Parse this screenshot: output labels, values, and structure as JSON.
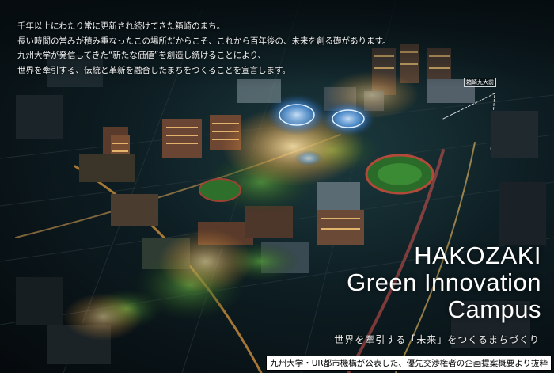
{
  "intro": {
    "lines": [
      "千年以上にわたり常に更新され続けてきた箱崎のまち。",
      "長い時間の営みが積み重なったこの場所だからこそ、これから百年後の、未来を創る礎があります。",
      "九州大学が発信してきた“新たな価値”を創造し続けることにより、",
      "世界を牽引する、伝統と革新を融合したまちをつくることを宣言します。"
    ]
  },
  "title": {
    "lines": [
      "HAKOZAKI",
      "Green Innovation",
      "Campus"
    ]
  },
  "tagline": "世界を牽引する「未来」をつくるまちづくり",
  "caption": "九州大学・UR都市機構が公表した、優先交渉権者の企画提案概要より抜粋",
  "sign": "箱崎九大前",
  "colors": {
    "background": "#0d1d22",
    "title": "#ffffff",
    "glow_blue": "#5aa8ff",
    "glow_warm": "#ffc86b"
  }
}
